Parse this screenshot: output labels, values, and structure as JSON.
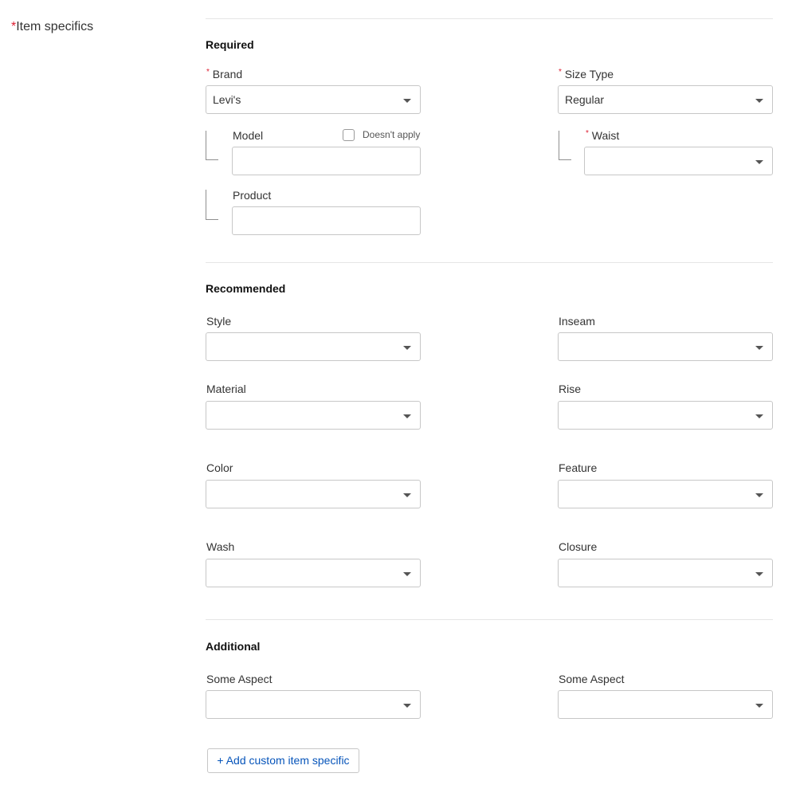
{
  "section": {
    "required_mark": "*",
    "title": "Item specifics"
  },
  "required": {
    "heading": "Required",
    "brand": {
      "mark": "*",
      "label": "Brand",
      "value": "Levi's"
    },
    "size_type": {
      "mark": "*",
      "label": "Size Type",
      "value": "Regular"
    },
    "model": {
      "label": "Model",
      "value": "",
      "doesnt_apply_label": "Doesn't apply",
      "doesnt_apply_checked": false
    },
    "waist": {
      "mark": "*",
      "label": "Waist",
      "value": ""
    },
    "product": {
      "label": "Product",
      "value": ""
    }
  },
  "recommended": {
    "heading": "Recommended",
    "style": {
      "label": "Style",
      "value": ""
    },
    "inseam": {
      "label": "Inseam",
      "value": ""
    },
    "material": {
      "label": "Material",
      "value": ""
    },
    "rise": {
      "label": "Rise",
      "value": ""
    },
    "color": {
      "label": "Color",
      "value": ""
    },
    "feature": {
      "label": "Feature",
      "value": ""
    },
    "wash": {
      "label": "Wash",
      "value": ""
    },
    "closure": {
      "label": "Closure",
      "value": ""
    }
  },
  "additional": {
    "heading": "Additional",
    "aspect_left": {
      "label": "Some Aspect",
      "value": ""
    },
    "aspect_right": {
      "label": "Some Aspect",
      "value": ""
    }
  },
  "add_custom_label": "+ Add custom item specific",
  "icons": {
    "dropdown": "caret-down-icon",
    "bracket": "connector-bracket-icon"
  },
  "colors": {
    "required_mark": "#dd1e31",
    "link": "#0654ba",
    "border": "#c7c7c7"
  }
}
